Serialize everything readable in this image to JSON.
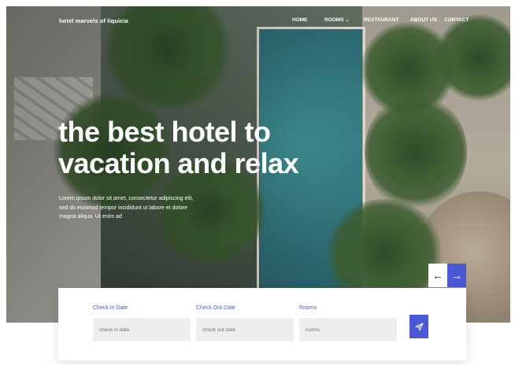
{
  "nav": {
    "brand": "hotel marvels of liquicia",
    "items": [
      {
        "label": "HOME"
      },
      {
        "label": "ROOMS",
        "dropdown": true
      },
      {
        "label": "RESTAURANT"
      },
      {
        "label": "ABOUT US"
      },
      {
        "label": "CONTACT"
      }
    ],
    "caret": "⌄"
  },
  "hero": {
    "title_line1": "the best hotel to",
    "title_line2": "vacation and relax",
    "text": "Lorem ipsum dolor sit amet, consectetur adipiscing elit, sed do eiusmod tempor incididunt ut labore et dolore magna aliqua. Ut enim ad"
  },
  "carousel": {
    "prev_icon": "←",
    "next_icon": "→"
  },
  "booking": {
    "check_in": {
      "label": "Check In Date",
      "placeholder": "check in date"
    },
    "check_out": {
      "label": "Check Out Date",
      "placeholder": "check out date"
    },
    "rooms": {
      "label": "Rooms",
      "placeholder": "rooms"
    },
    "submit_icon": "paper-plane-icon"
  },
  "colors": {
    "accent": "#4a58d6",
    "text_light": "#ffffff",
    "field_bg": "#eeeeee"
  }
}
